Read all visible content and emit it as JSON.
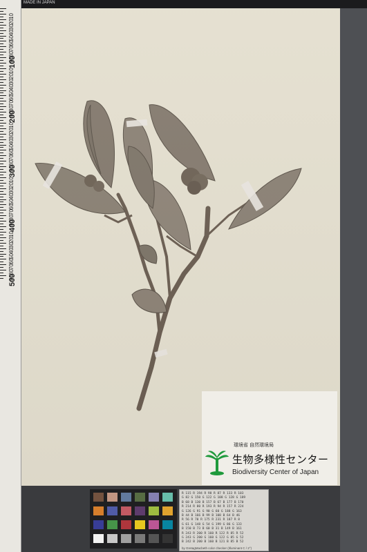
{
  "label": {
    "ministry_text": "環境省 自然環境局",
    "title_jp": "生物多様性センター",
    "title_en": "Biodiversity Center of Japan"
  },
  "ruler": {
    "top_text": "MADE IN JAPAN",
    "labels": [
      "10",
      "20",
      "30",
      "40",
      "50",
      "60",
      "70",
      "80",
      "90",
      "100",
      "10",
      "20",
      "30",
      "40",
      "50",
      "60",
      "70",
      "80",
      "90",
      "200",
      "10",
      "20",
      "30",
      "40",
      "50",
      "60",
      "70",
      "80",
      "90",
      "300",
      "10",
      "20",
      "30",
      "40",
      "50",
      "60",
      "70",
      "80",
      "90",
      "400",
      "10",
      "20",
      "30",
      "40",
      "50",
      "60",
      "70",
      "80",
      "90",
      "500"
    ]
  },
  "color_card": {
    "rows": [
      "R 115  R 194  R 98   R 87   R 133  R 103",
      "G 82   G 150  G 122  G 108  G 128  G 189",
      "B 68   B 130  B 157  B 67   B 177  B 170",
      "R 214  R 80   R 193  R 94   R 157  R 224",
      "G 126  G 91   G 90   G 60   G 188  G 163",
      "B 44   B 166  B 99   B 108  B 64   B 46",
      "R 56   R 70   R 175  R 231  R 187  R 8",
      "G 61   G 148  G 54   G 199  G 86   G 133",
      "B 150  B 73   B 60   B 31   B 149  B 161",
      "R 243  R 200  R 160  R 122  R 85   R 52",
      "G 243  G 200  G 160  G 122  G 85   G 52",
      "B 242  B 200  B 160  B 121  B 85   B 52"
    ],
    "caption": "by GretagMacbeth color checker (Illuminant C / 2°)"
  },
  "colors": {
    "sheet": "#e4dfcf",
    "leaf": "#8d8478",
    "stem": "#6b5e52",
    "logo_green": "#1f9a3c"
  }
}
